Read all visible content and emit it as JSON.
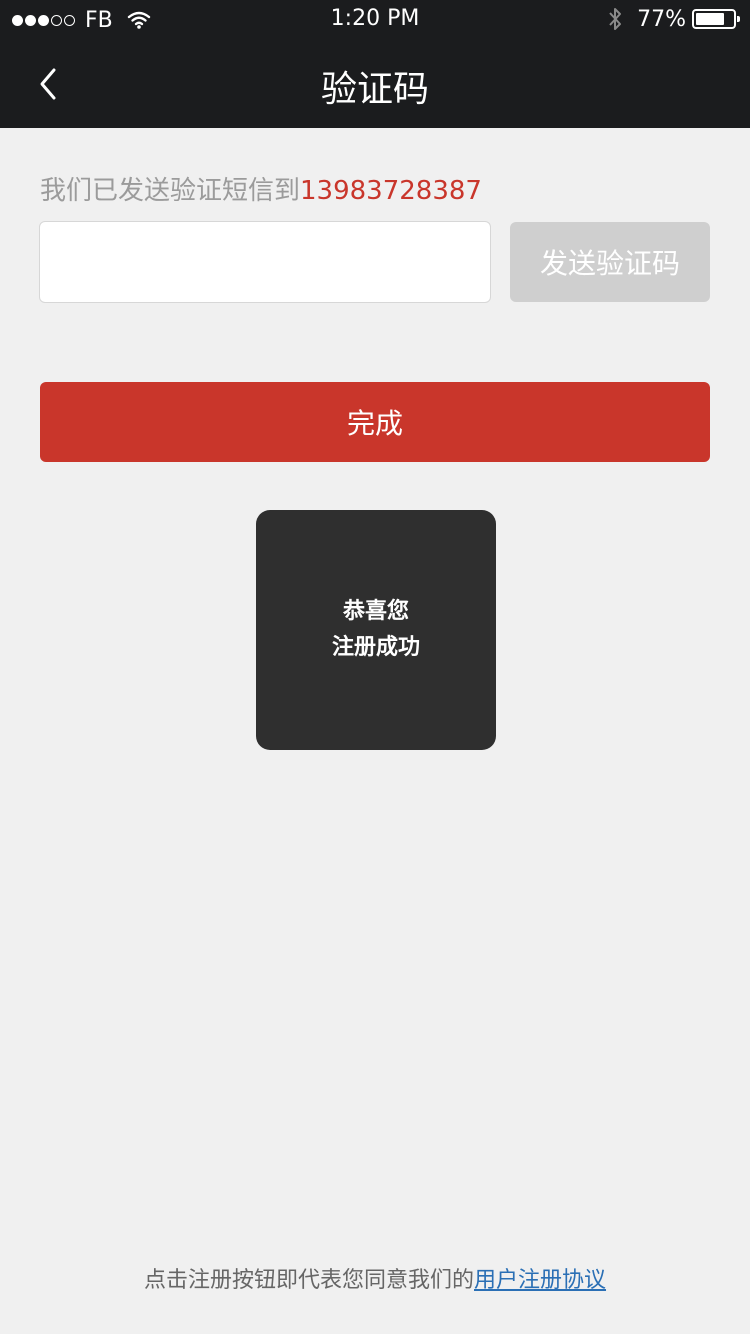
{
  "status_bar": {
    "carrier": "FB",
    "time": "1:20 PM",
    "battery": "77%",
    "battery_level": 0.77,
    "signal_bars_filled": 3,
    "signal_bars_total": 5
  },
  "nav": {
    "title": "验证码",
    "back_icon": "chevron-left-icon"
  },
  "form": {
    "hint_prefix": "我们已发送验证短信到",
    "phone_number": "13983728387",
    "code_value": "",
    "code_placeholder": "",
    "send_code_label": "发送验证码",
    "done_label": "完成"
  },
  "toast": {
    "line1": "恭喜您",
    "line2": "注册成功"
  },
  "footer": {
    "text": "点击注册按钮即代表您同意我们的",
    "link": "用户注册协议"
  },
  "colors": {
    "header_bg": "#1b1c1e",
    "accent_red": "#c9362b",
    "disabled_gray": "#cfcfcf",
    "link_blue": "#2a6fb5"
  }
}
